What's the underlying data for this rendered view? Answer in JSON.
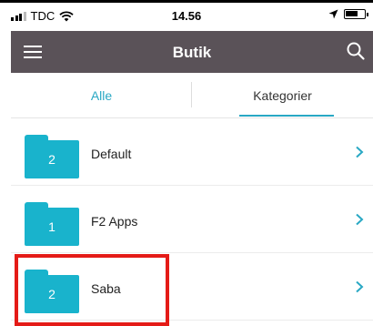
{
  "status_bar": {
    "carrier": "TDC",
    "time": "14.56"
  },
  "navbar": {
    "title": "Butik"
  },
  "tabs": {
    "all_label": "Alle",
    "categories_label": "Kategorier",
    "selected": "Kategorier"
  },
  "list": {
    "items": [
      {
        "count": "2",
        "label": "Default"
      },
      {
        "count": "1",
        "label": "F2 Apps"
      },
      {
        "count": "2",
        "label": "Saba"
      }
    ]
  },
  "colors": {
    "accent": "#29a8c4",
    "folder": "#19b3cc",
    "navbar": "#5a5258",
    "highlight": "#e41b17"
  },
  "icons": [
    "signal-icon",
    "wifi-icon",
    "location-icon",
    "battery-icon",
    "hamburger-icon",
    "search-icon",
    "folder-icon",
    "chevron-right-icon"
  ]
}
